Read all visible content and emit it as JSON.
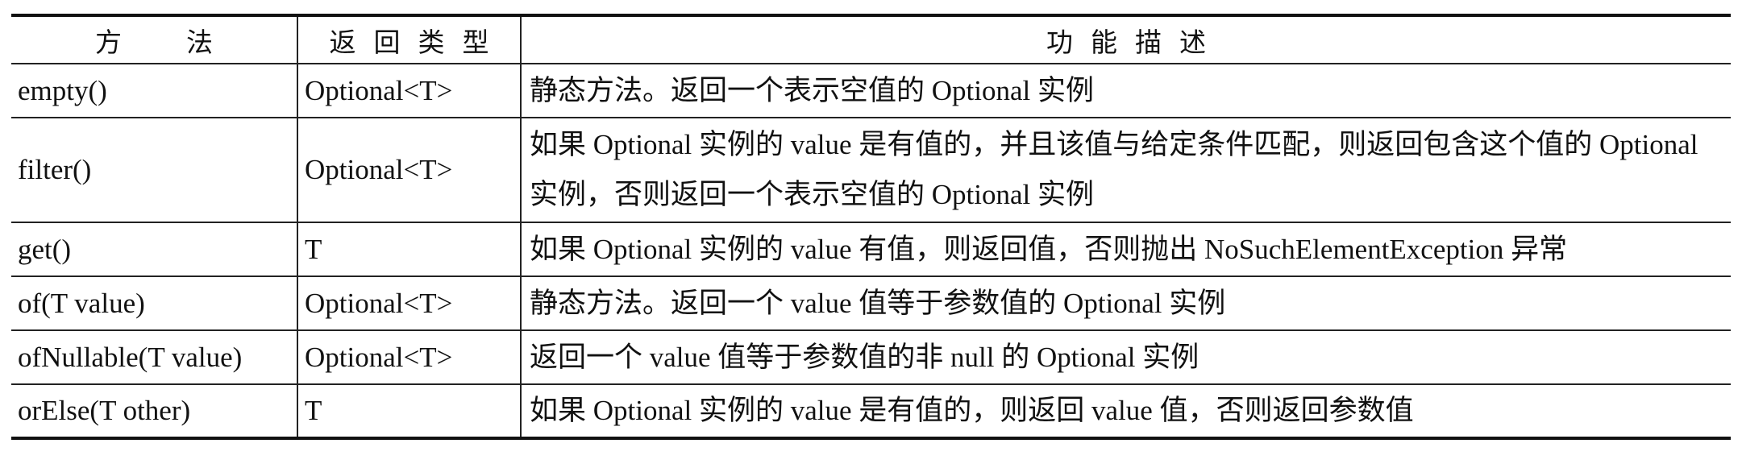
{
  "table": {
    "headers": {
      "method": "方法",
      "return_type": "返回类型",
      "description": "功能描述"
    },
    "rows": [
      {
        "method": "empty()",
        "return_type": "Optional<T>",
        "description": "静态方法。返回一个表示空值的 Optional 实例"
      },
      {
        "method": "filter()",
        "return_type": "Optional<T>",
        "description": "如果 Optional 实例的 value 是有值的，并且该值与给定条件匹配，则返回包含这个值的 Optional 实例，否则返回一个表示空值的 Optional 实例"
      },
      {
        "method": "get()",
        "return_type": "T",
        "description": "如果 Optional 实例的 value 有值，则返回值，否则抛出 NoSuchElementException 异常"
      },
      {
        "method": "of(T value)",
        "return_type": "Optional<T>",
        "description": "静态方法。返回一个 value 值等于参数值的 Optional 实例"
      },
      {
        "method": "ofNullable(T value)",
        "return_type": "Optional<T>",
        "description": "返回一个 value 值等于参数值的非 null 的 Optional 实例"
      },
      {
        "method": "orElse(T other)",
        "return_type": "T",
        "description": "如果 Optional 实例的 value 是有值的，则返回 value 值，否则返回参数值"
      }
    ]
  }
}
